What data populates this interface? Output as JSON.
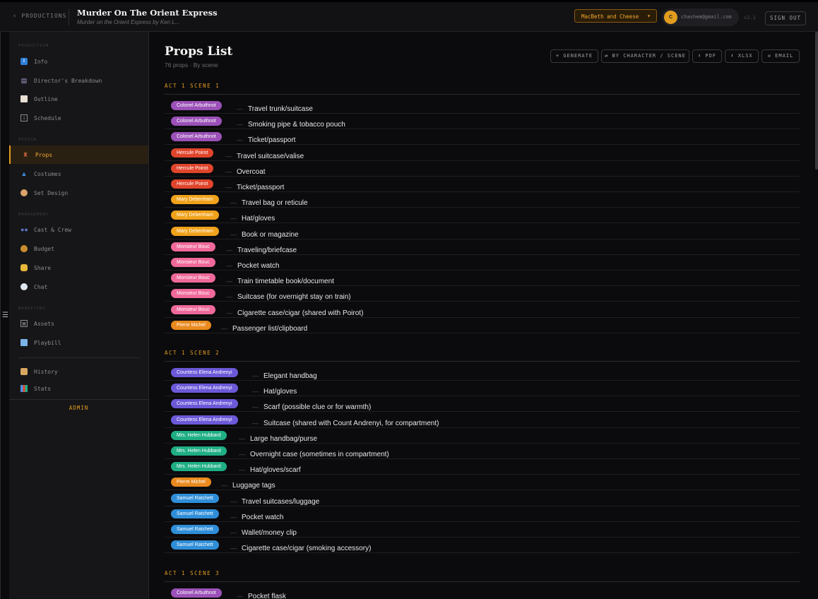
{
  "topbar": {
    "back_label": "PRODUCTIONS",
    "title": "Murder On The Orient Express",
    "subtitle": "Murder on the Orient Express by Ken L...",
    "company": "MacBeth and Cheese",
    "avatar_initial": "C",
    "email": "chashem@gmail.com",
    "version": "v2.1",
    "sign_out": "SIGN OUT"
  },
  "sidebar": {
    "sections": [
      "PRODUCTION",
      "DESIGN",
      "MANAGEMENT",
      "MARKETING"
    ],
    "items": [
      {
        "label": "Info",
        "icon": "info-icon"
      },
      {
        "label": "Director's Breakdown",
        "icon": "clapper-icon"
      },
      {
        "label": "Outline",
        "icon": "document-icon"
      },
      {
        "label": "Schedule",
        "icon": "calendar-icon"
      },
      {
        "label": "Props",
        "icon": "chair-icon"
      },
      {
        "label": "Costumes",
        "icon": "dress-icon"
      },
      {
        "label": "Set Design",
        "icon": "palette-icon"
      },
      {
        "label": "Cast & Crew",
        "icon": "people-icon"
      },
      {
        "label": "Budget",
        "icon": "money-bag-icon"
      },
      {
        "label": "Share",
        "icon": "handshake-icon"
      },
      {
        "label": "Chat",
        "icon": "chat-icon"
      },
      {
        "label": "Assets",
        "icon": "image-icon"
      },
      {
        "label": "Playbill",
        "icon": "book-icon"
      },
      {
        "label": "History",
        "icon": "scroll-icon"
      },
      {
        "label": "Stats",
        "icon": "chart-icon"
      }
    ],
    "admin": "ADMIN"
  },
  "main": {
    "title": "Props List",
    "subtitle": "76 props · By scene",
    "toolbar": {
      "generate": "+ GENERATE",
      "by_character": "⇄ BY CHARACTER / SCENE",
      "pdf": "⬇ PDF",
      "xlsx": "⬇ XLSX",
      "email": "✉ EMAIL"
    },
    "colors": {
      "Colonel Arbuthnot": "#9b51b8",
      "Hercule Poirot": "#e0452c",
      "Mary Debenham": "#f0a21b",
      "Monsieur Bouc": "#f0699a",
      "Pierre Michel": "#ea8a1e",
      "Countess Elena Andrenyi": "#6c59d8",
      "Mrs. Helen Hubbard": "#1fae85",
      "Samuel Ratchett": "#2f8ed8"
    },
    "scenes": [
      {
        "title": "ACT 1 SCENE 1",
        "rows": [
          {
            "character": "Colonel Arbuthnot",
            "prop": "Travel trunk/suitcase"
          },
          {
            "character": "Colonel Arbuthnot",
            "prop": "Smoking pipe & tobacco pouch"
          },
          {
            "character": "Colonel Arbuthnot",
            "prop": "Ticket/passport"
          },
          {
            "character": "Hercule Poirot",
            "prop": "Travel suitcase/valise"
          },
          {
            "character": "Hercule Poirot",
            "prop": "Overcoat"
          },
          {
            "character": "Hercule Poirot",
            "prop": "Ticket/passport"
          },
          {
            "character": "Mary Debenham",
            "prop": "Travel bag or reticule"
          },
          {
            "character": "Mary Debenham",
            "prop": "Hat/gloves"
          },
          {
            "character": "Mary Debenham",
            "prop": "Book or magazine"
          },
          {
            "character": "Monsieur Bouc",
            "prop": "Traveling/briefcase"
          },
          {
            "character": "Monsieur Bouc",
            "prop": "Pocket watch"
          },
          {
            "character": "Monsieur Bouc",
            "prop": "Train timetable book/document"
          },
          {
            "character": "Monsieur Bouc",
            "prop": "Suitcase (for overnight stay on train)"
          },
          {
            "character": "Monsieur Bouc",
            "prop": "Cigarette case/cigar (shared with Poirot)"
          },
          {
            "character": "Pierre Michel",
            "prop": "Passenger list/clipboard"
          }
        ]
      },
      {
        "title": "ACT 1 SCENE 2",
        "rows": [
          {
            "character": "Countess Elena Andrenyi",
            "prop": "Elegant handbag"
          },
          {
            "character": "Countess Elena Andrenyi",
            "prop": "Hat/gloves"
          },
          {
            "character": "Countess Elena Andrenyi",
            "prop": "Scarf (possible clue or for warmth)"
          },
          {
            "character": "Countess Elena Andrenyi",
            "prop": "Suitcase (shared with Count Andrenyi, for compartment)"
          },
          {
            "character": "Mrs. Helen Hubbard",
            "prop": "Large handbag/purse"
          },
          {
            "character": "Mrs. Helen Hubbard",
            "prop": "Overnight case (sometimes in compartment)"
          },
          {
            "character": "Mrs. Helen Hubbard",
            "prop": "Hat/gloves/scarf"
          },
          {
            "character": "Pierre Michel",
            "prop": "Luggage tags"
          },
          {
            "character": "Samuel Ratchett",
            "prop": "Travel suitcases/luggage"
          },
          {
            "character": "Samuel Ratchett",
            "prop": "Pocket watch"
          },
          {
            "character": "Samuel Ratchett",
            "prop": "Wallet/money clip"
          },
          {
            "character": "Samuel Ratchett",
            "prop": "Cigarette case/cigar (smoking accessory)"
          }
        ]
      },
      {
        "title": "ACT 1 SCENE 3",
        "rows": [
          {
            "character": "Colonel Arbuthnot",
            "prop": "Pocket flask"
          }
        ]
      }
    ]
  }
}
